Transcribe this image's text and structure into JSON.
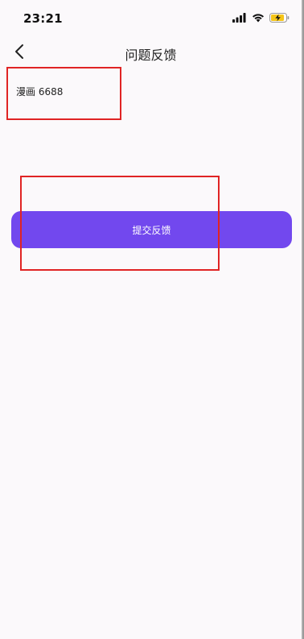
{
  "status_bar": {
    "time": "23:21"
  },
  "nav": {
    "title": "问题反馈"
  },
  "feedback": {
    "text": "漫画 6688"
  },
  "actions": {
    "submit_label": "提交反馈"
  },
  "colors": {
    "accent": "#7248ee",
    "background": "#fbf9fb",
    "annotation": "#e02424"
  },
  "icons": {
    "back": "chevron-left-icon",
    "signal": "signal-icon",
    "wifi": "wifi-icon",
    "battery": "battery-charging-icon"
  }
}
